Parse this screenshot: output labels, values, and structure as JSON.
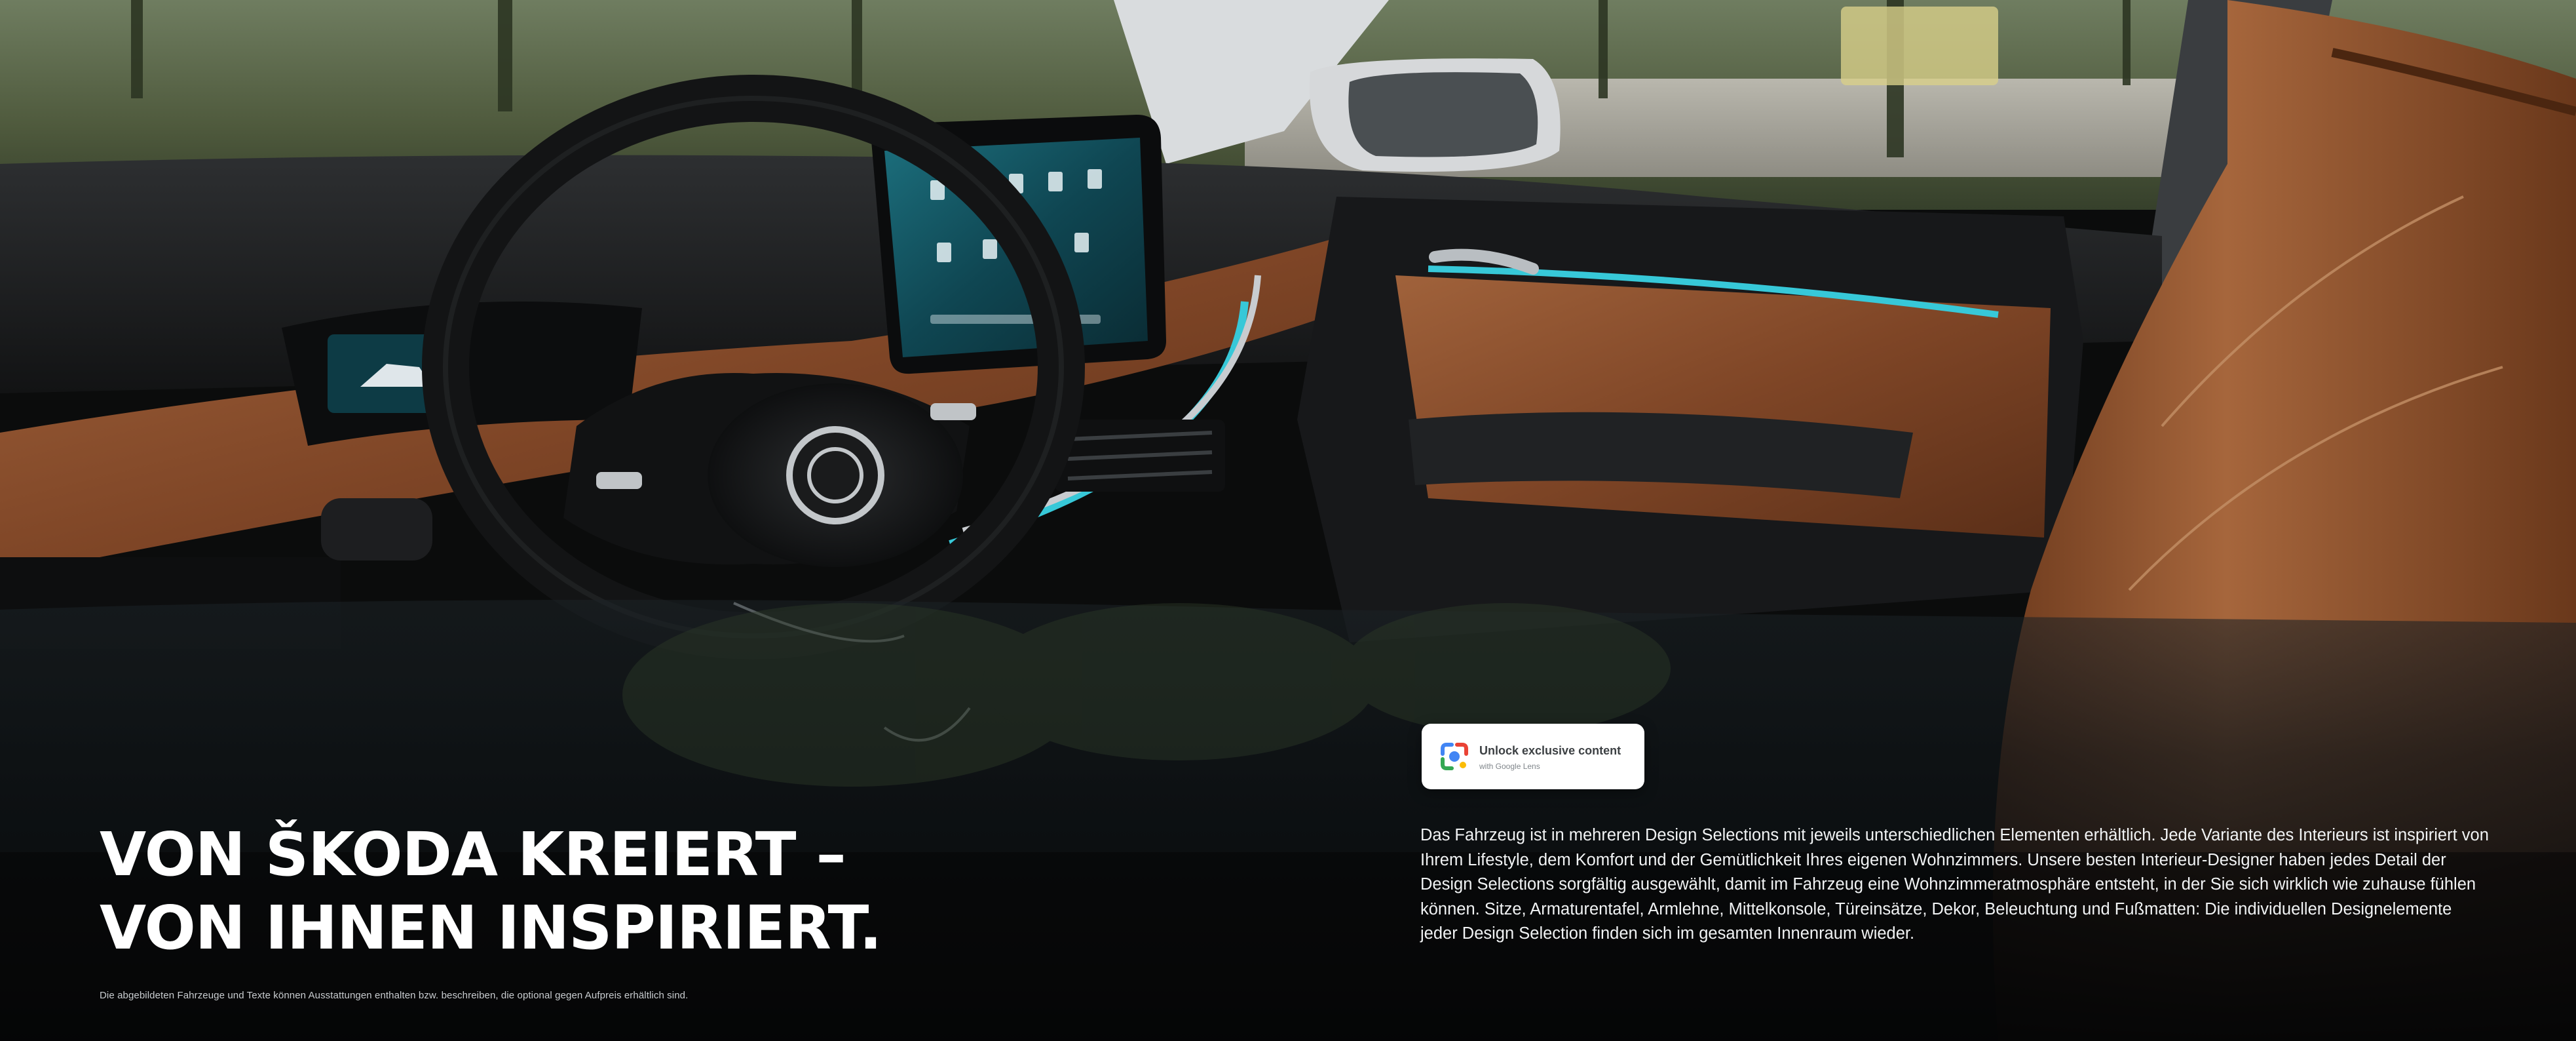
{
  "headline": {
    "line1": "VON ŠKODA KREIERT –",
    "line2": "VON IHNEN INSPIRIERT."
  },
  "body_lines": [
    "Das Fahrzeug ist in mehreren Design Selections mit jeweils unterschiedlichen Elementen erhältlich. Jede Variante des Interieurs ist inspiriert von",
    "Ihrem Lifestyle, dem Komfort und der Gemütlichkeit Ihres eigenen Wohnzimmers. Unsere besten Interieur-Designer haben jedes Detail der",
    "Design Selections sorgfältig ausgewählt, damit im Fahrzeug eine Wohnzimmeratmosphäre entsteht, in der Sie sich wirklich wie zuhause fühlen",
    "können. Sitze, Armaturentafel, Armlehne, Mittelkonsole, Türeinsätze, Dekor, Beleuchtung und Fußmatten: Die individuellen Designelemente",
    "jeder Design Selection finden sich im gesamten Innenraum wieder."
  ],
  "disclaimer": "Die abgebildeten Fahrzeuge und Texte können Ausstattungen enthalten bzw. beschreiben, die optional gegen Aufpreis erhältlich sind.",
  "lens_badge": {
    "title": "Unlock exclusive content",
    "subtitle": "with Google Lens",
    "icon": "google-lens-icon"
  },
  "colors": {
    "headline": "#ffffff",
    "body_text": "#f1f3f4",
    "leather": "#8a4f2c",
    "ambient_light": "#37c8d8",
    "background": "#0b0c0c"
  }
}
